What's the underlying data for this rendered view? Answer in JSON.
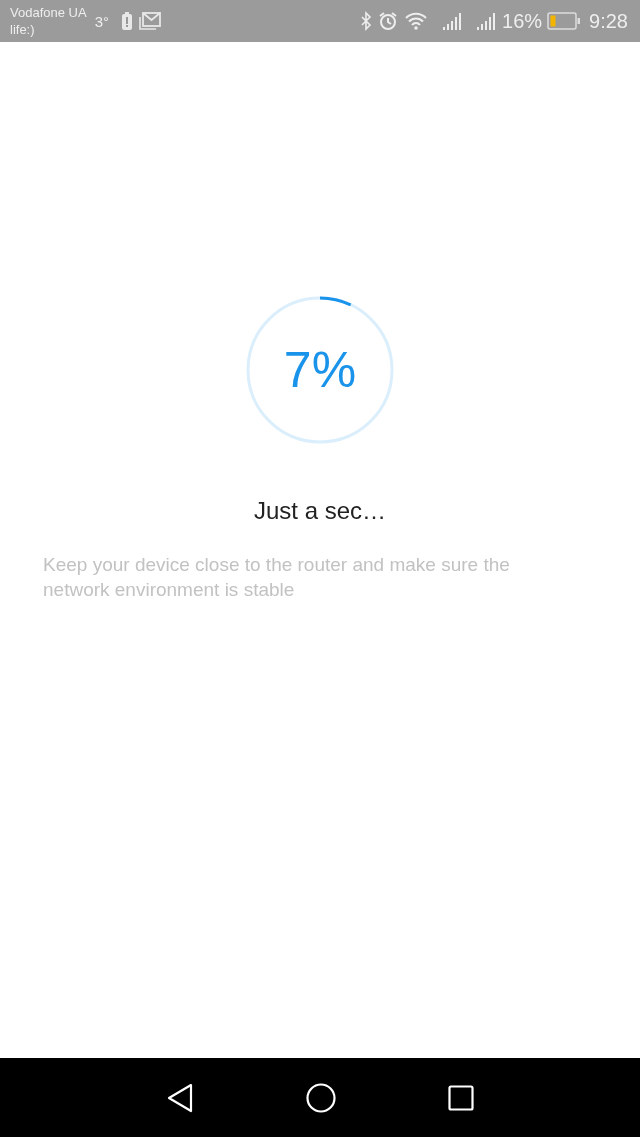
{
  "status_bar": {
    "carrier_lines": [
      "Vodafone UA",
      "life:)"
    ],
    "temperature": "3°",
    "battery_percent": "16%",
    "time": "9:28"
  },
  "progress": {
    "reading": "7%"
  },
  "title": "Just a sec…",
  "message": "Keep your device close to the router and make sure the network environment is stable"
}
